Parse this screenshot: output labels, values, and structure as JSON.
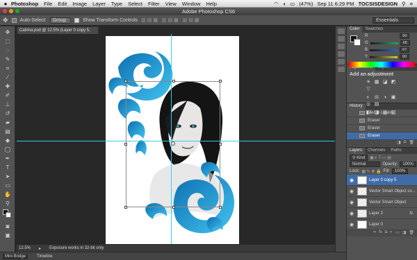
{
  "menubar": {
    "apple": "",
    "app_name": "Photoshop",
    "items": [
      "File",
      "Edit",
      "Image",
      "Layer",
      "Type",
      "Select",
      "Filter",
      "View",
      "Window",
      "Help"
    ],
    "battery": "(47%)",
    "clock": "Sep 11 6:29 PM",
    "user": "TOCSISDESIGN"
  },
  "window": {
    "title": "Adobe Photoshop CS6"
  },
  "options": {
    "auto_select_label": "Auto-Select:",
    "auto_select_value": "Group",
    "show_transform_label": "Show Transform Controls",
    "workspace": "Essentials"
  },
  "document": {
    "tab_title": "Catrina.psd @ 12.5% (Layer 0 copy 5, RGB/8) *"
  },
  "statusbar": {
    "zoom": "12.5%",
    "message": "Exposure works in 32-bit only"
  },
  "bottom_tabs": [
    "Mini Bridge",
    "Timeline"
  ],
  "color_panel": {
    "tabs": [
      "Color",
      "Swatches"
    ],
    "channels": [
      {
        "label": "R",
        "value": "90"
      },
      {
        "label": "G",
        "value": "68"
      },
      {
        "label": "B",
        "value": "67"
      },
      {
        "label": "Y",
        "value": "90"
      }
    ]
  },
  "adjustments_panel": {
    "tabs": [
      "Adjustments",
      "Styles"
    ],
    "heading": "Add an adjustment",
    "row1": [
      "☀",
      "▦",
      "◪",
      "◩",
      "▽"
    ],
    "row2": [
      "◐",
      "⚖",
      "◑",
      "▣",
      "◎",
      "▤"
    ],
    "row3": [
      "◧",
      "◨",
      "▥",
      "▧"
    ]
  },
  "history_panel": {
    "tab": "History",
    "items": [
      "Merge Layers",
      "Eraser",
      "Eraser",
      "Eraser"
    ]
  },
  "layers_panel": {
    "tabs": [
      "Layers",
      "Channels",
      "Paths"
    ],
    "kind": "Kind",
    "blend_mode": "Normal",
    "opacity_label": "Opacity:",
    "opacity": "100%",
    "lock_label": "Lock:",
    "fill_label": "Fill:",
    "fill": "100%",
    "layers": [
      {
        "name": "Layer 0 copy 5",
        "fx": ""
      },
      {
        "name": "Vector Smart Object co...",
        "fx": ""
      },
      {
        "name": "Vector Smart Object",
        "fx": ""
      },
      {
        "name": "Layer 2",
        "fx": "fx"
      },
      {
        "name": "Layer 0",
        "fx": ""
      }
    ]
  },
  "colors": {
    "accent": "#3f6ca9",
    "guide": "#2fd0e6",
    "swirl": "#1a9ad6",
    "panel": "#535353"
  }
}
